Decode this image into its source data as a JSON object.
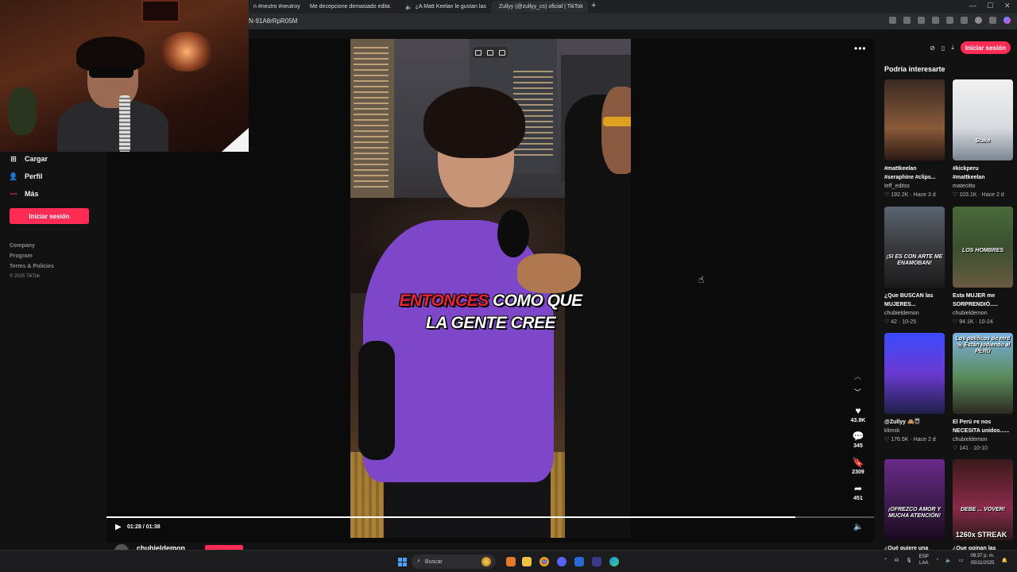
{
  "browser": {
    "tabs": [
      {
        "label": "n #neutro #neutroy",
        "active": false
      },
      {
        "label": "Me decepcione demasiado edita",
        "active": false
      },
      {
        "label": "¿A Matt Keelan le gustan las",
        "active": false
      },
      {
        "label": "Zullyy (@zullyy_cs) oficial | TikTok",
        "active": true
      }
    ],
    "url": "N-91A8rRpR05M"
  },
  "sidebar": {
    "items": [
      {
        "label": "Cargar",
        "icon": "upload-icon"
      },
      {
        "label": "Perfil",
        "icon": "profile-icon"
      },
      {
        "label": "Más",
        "icon": "more-icon"
      }
    ],
    "login_label": "Iniciar sesión",
    "footer": [
      "Company",
      "Program",
      "Terms & Policies"
    ],
    "copyright": "© 2025 TikTok"
  },
  "video": {
    "caption_red": "ENTONCES",
    "caption_white": " COMO QUE",
    "caption_line2": "LA GENTE CREE",
    "time": "01:28 / 01:38",
    "progress": 0.898,
    "likes": "43.9K",
    "comments": "345",
    "saves": "2309",
    "shares": "451",
    "author": "chubieldemon",
    "more_label": "•••"
  },
  "rail": {
    "login_label": "Iniciar sesión",
    "title": "Podría interesarte",
    "cards": [
      {
        "title1": "#mattkeelan",
        "title2": "#seraphine #clips...",
        "author": "teff_editss",
        "likes": "192.2K",
        "date": "Hace 3 d",
        "thumb_text": "",
        "bg": "linear-gradient(180deg,#3a2a22,#8a5a3a 60%,#2a1a14)"
      },
      {
        "title1": "#kickperu",
        "title2": "#mattkeelan",
        "author": "matecitto",
        "likes": "103.1K",
        "date": "Hace 2 d",
        "thumb_text": "Stake",
        "bg": "linear-gradient(180deg,#f0f0f0,#d8dbe0 60%,#7a8490)"
      },
      {
        "title1": "¿Que BUSCAN las",
        "title2": "MUJERES...",
        "author": "chubieldemon",
        "likes": "42",
        "date": "10-25",
        "thumb_text": "¡SI ES CON ARTE ME ENAMOBAN!",
        "bg": "linear-gradient(180deg,#5a6470,#3a3a3e 50%,#1a1a1c)"
      },
      {
        "title1": "Esta MUJER me",
        "title2": "SORPRENDIÓ.....",
        "author": "chubieldemon",
        "likes": "94.1K",
        "date": "10-24",
        "thumb_text": "LOS HOMBRES",
        "bg": "linear-gradient(180deg,#4a6a3a,#3a5030 50%,#6a5a40)"
      },
      {
        "title1": "@Zullyy 🙈😇",
        "title2": "",
        "author": "klimxk",
        "likes": "176.5K",
        "date": "Hace 2 d",
        "thumb_text": "",
        "bg": "linear-gradient(180deg,#3a4aff,#6a3ad0 50%,#20204a)"
      },
      {
        "title1": "El Perú ᴘᴇ nos",
        "title2": "NECESITA unidos......",
        "author": "chubieldemon",
        "likes": "141",
        "date": "10-10",
        "thumb_text": "Los políticos de mrd 🐀 Están jodiendo al PERÚ",
        "bg": "linear-gradient(180deg,#7ab0e0,#5a8a5a 55%,#2a2a20)"
      },
      {
        "title1": "¿Qué quiere una",
        "title2": "",
        "author": "",
        "likes": "",
        "date": "",
        "thumb_text": "¡OFREZCO AMOR Y MUCHA ATENCIÓN!",
        "bg": "linear-gradient(180deg,#6a2a8a,#3a1a4a 60%,#1a0a20)"
      },
      {
        "title1": "¿Que opinan las",
        "title2": "",
        "author": "",
        "likes": "",
        "date": "",
        "thumb_text": "DEBE ... VOVER!",
        "bg": "linear-gradient(180deg,#3a1a1a,#8a2a4a 60%,#2a1a1a)"
      }
    ],
    "streak_label": "1260x STREAK"
  },
  "taskbar": {
    "search_placeholder": "Buscar",
    "lang": "ESP",
    "lang2": "LAA",
    "time": "09:37 p. m.",
    "date": "05/11/2025"
  },
  "colors": {
    "accent": "#fe2c55",
    "shirt": "#7e46c9"
  }
}
